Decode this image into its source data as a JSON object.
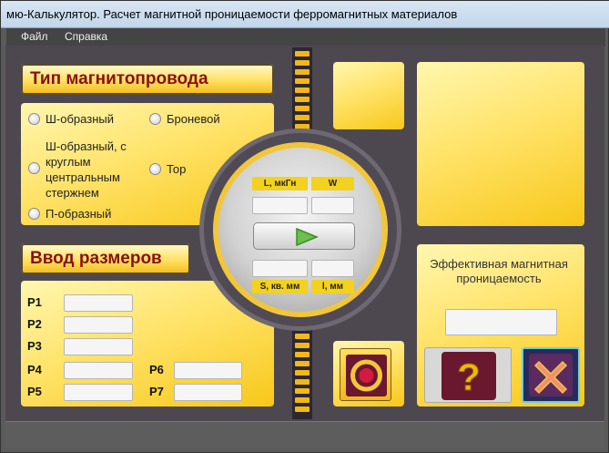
{
  "window": {
    "title": "мю-Калькулятор. Расчет магнитной проницаемости ферромагнитных материалов"
  },
  "menu": {
    "file": "Файл",
    "help": "Справка"
  },
  "core_type": {
    "heading": "Тип магнитопровода",
    "options": [
      "Ш-образный",
      "Броневой",
      "Ш-образный, с круглым центральным стержнем",
      "Тор",
      "П-образный"
    ]
  },
  "dimensions": {
    "heading": "Ввод размеров",
    "params": [
      "P1",
      "P2",
      "P3",
      "P4",
      "P5",
      "P6",
      "P7"
    ]
  },
  "calc": {
    "L_label": "L, мкГн",
    "W_label": "W",
    "S_label": "S, кв. мм",
    "l_label": "l, мм"
  },
  "result": {
    "title": "Эффективная магнитная проницаемость"
  },
  "icons": {
    "calculate": "play-icon",
    "record": "record-icon",
    "help": "question-icon",
    "close": "close-icon"
  },
  "colors": {
    "accent": "#f7c81a",
    "heading_text": "#8a1010",
    "play": "#6ac04a",
    "record": "#d41a40",
    "help": "#f0b800",
    "close": "#f09070"
  }
}
